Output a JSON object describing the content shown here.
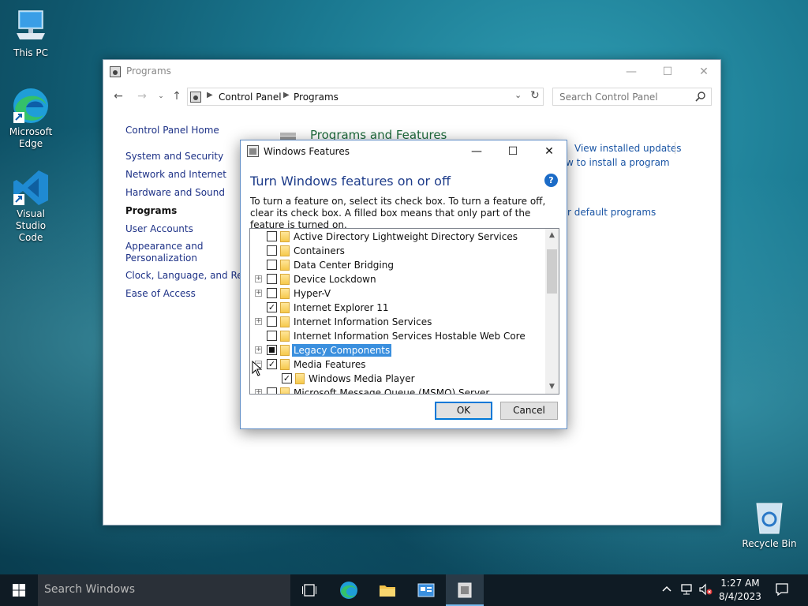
{
  "desktop": {
    "icons": [
      {
        "label": "This PC"
      },
      {
        "label": "Microsoft Edge"
      },
      {
        "label": "Visual Studio Code"
      },
      {
        "label": "Recycle Bin"
      }
    ]
  },
  "control_panel": {
    "title": "Programs",
    "breadcrumb": [
      "Control Panel",
      "Programs"
    ],
    "search_placeholder": "Search Control Panel",
    "sidenav": {
      "home": "Control Panel Home",
      "items": [
        "System and Security",
        "Network and Internet",
        "Hardware and Sound",
        "Programs",
        "User Accounts",
        "Appearance and Personalization",
        "Clock, Language, and Region",
        "Ease of Access"
      ]
    },
    "section_title": "Programs and Features",
    "links": {
      "view_updates": "View installed updates",
      "install_program": "w to install a program",
      "default_programs": "r default programs"
    }
  },
  "windows_features": {
    "title": "Windows Features",
    "heading": "Turn Windows features on or off",
    "description": "To turn a feature on, select its check box. To turn a feature off, clear its check box. A filled box means that only part of the feature is turned on.",
    "features": [
      {
        "label": "Active Directory Lightweight Directory Services",
        "state": "unchecked",
        "expandable": false,
        "level": 0,
        "selected": false
      },
      {
        "label": "Containers",
        "state": "unchecked",
        "expandable": false,
        "level": 0,
        "selected": false
      },
      {
        "label": "Data Center Bridging",
        "state": "unchecked",
        "expandable": false,
        "level": 0,
        "selected": false
      },
      {
        "label": "Device Lockdown",
        "state": "unchecked",
        "expandable": true,
        "level": 0,
        "selected": false
      },
      {
        "label": "Hyper-V",
        "state": "unchecked",
        "expandable": true,
        "level": 0,
        "selected": false
      },
      {
        "label": "Internet Explorer 11",
        "state": "checked",
        "expandable": false,
        "level": 0,
        "selected": false
      },
      {
        "label": "Internet Information Services",
        "state": "unchecked",
        "expandable": true,
        "level": 0,
        "selected": false
      },
      {
        "label": "Internet Information Services Hostable Web Core",
        "state": "unchecked",
        "expandable": false,
        "level": 0,
        "selected": false
      },
      {
        "label": "Legacy Components",
        "state": "partial",
        "expandable": true,
        "level": 0,
        "selected": true
      },
      {
        "label": "Media Features",
        "state": "checked",
        "expandable": true,
        "expanded": true,
        "level": 0,
        "selected": false
      },
      {
        "label": "Windows Media Player",
        "state": "checked",
        "expandable": false,
        "level": 1,
        "selected": false
      },
      {
        "label": "Microsoft Message Queue (MSMQ) Server",
        "state": "unchecked",
        "expandable": true,
        "level": 0,
        "selected": false
      }
    ],
    "ok_label": "OK",
    "cancel_label": "Cancel"
  },
  "taskbar": {
    "search_placeholder": "Search Windows",
    "time": "1:27 AM",
    "date": "8/4/2023"
  },
  "colors": {
    "accent": "#0078d7",
    "link": "#1a55a5",
    "heading": "#1e3c8a",
    "selection": "#3a8fde"
  }
}
